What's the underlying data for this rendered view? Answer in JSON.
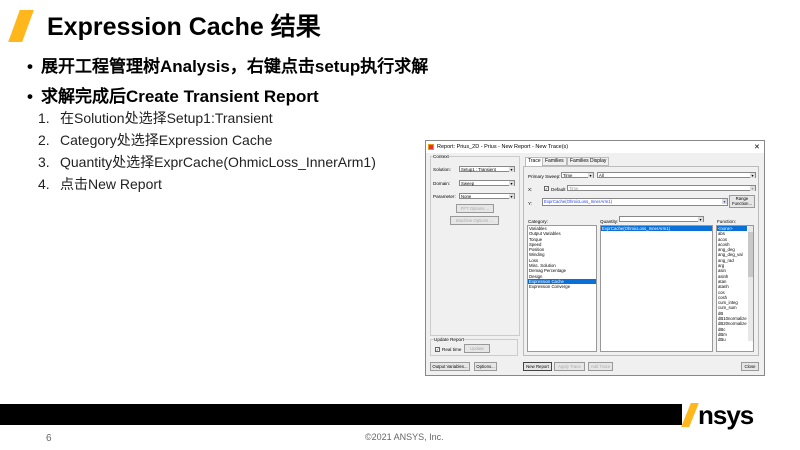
{
  "slide": {
    "title": "Expression Cache 结果",
    "bullets": [
      "展开工程管理树Analysis，右键点击setup执行求解",
      "求解完成后Create Transient Report"
    ],
    "steps": [
      {
        "n": "1.",
        "text": "在Solution处选择Setup1:Transient"
      },
      {
        "n": "2.",
        "text": "Category处选择Expression Cache"
      },
      {
        "n": "3.",
        "text": "Quantity处选择ExprCache(OhmicLoss_InnerArm1)"
      },
      {
        "n": "4.",
        "text": "点击New Report"
      }
    ],
    "page_number": "6",
    "copyright": "©2021 ANSYS, Inc.",
    "logo": "Ansys"
  },
  "dialog": {
    "title": "Report: Prius_2D - Prius - New Report - New Trace(s)",
    "close": "✕",
    "context_label": "Context",
    "solution_label": "Solution:",
    "solution": "Setup1 : Transient",
    "domain_label": "Domain:",
    "domain": "Sweep",
    "parameter_label": "Parameter:",
    "parameter": "None",
    "fft_btn": "FFT Options ...",
    "machine_btn": "Machine Options ...",
    "update_label": "Update Report",
    "realtime": "Real time",
    "update_btn": "Update",
    "output_vars_btn": "Output Variables...",
    "options_btn": "Options...",
    "tabs": [
      "Trace",
      "Families",
      "Families Display"
    ],
    "primary_sweep_label": "Primary Sweep:",
    "primary_sweep": "Time",
    "all": "All",
    "x_label": "X:",
    "default": "Default",
    "x_value": "Time",
    "y_label": "Y:",
    "y_value": "ExprCache(OhmicLoss_InnerArm1)",
    "range_btn": [
      "Range",
      "Function..."
    ],
    "category_label": "Category:",
    "categories": [
      "Variables",
      "Output Variables",
      "Torque",
      "Speed",
      "Position",
      "Winding",
      "Loss",
      "Misc. Solution",
      "Demag Percentage",
      "Design",
      "Expression Cache",
      "Expression Converge"
    ],
    "category_selected": "Expression Cache",
    "quantity_label": "Quantity:",
    "quantities": [
      "ExprCache(OhmicLoss_InnerArm1)"
    ],
    "function_label": "Function:",
    "functions": [
      "<none>",
      "abs",
      "acos",
      "acosh",
      "ang_deg",
      "ang_deg_val",
      "ang_rad",
      "arg",
      "asin",
      "asinh",
      "atan",
      "atanh",
      "cos",
      "cosh",
      "cum_integ",
      "cum_sum",
      "dB",
      "dB10normalize",
      "dB20normalize",
      "dBc",
      "dBm",
      "dBu"
    ],
    "new_report_btn": "New Report",
    "apply_trace_btn": "Apply Trace",
    "add_trace_btn": "Add Trace",
    "close_btn": "Close"
  }
}
